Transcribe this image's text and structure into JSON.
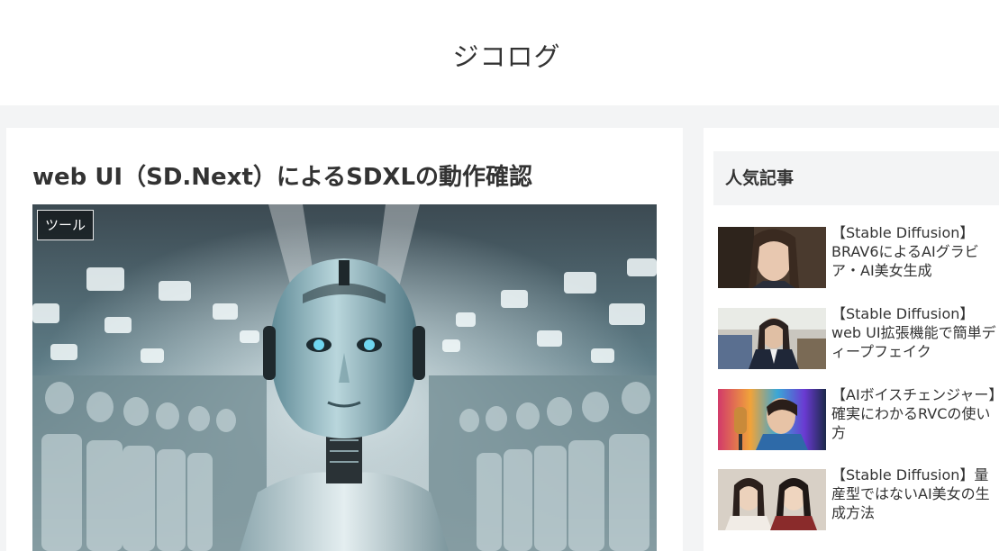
{
  "header": {
    "site_title": "ジコログ"
  },
  "article": {
    "title": "web UI（SD.Next）によるSDXLの動作確認",
    "category": "ツール"
  },
  "sidebar": {
    "widget_title": "人気記事",
    "items": [
      {
        "title": "【Stable Diffusion】BRAV6によるAIグラビア・AI美女生成"
      },
      {
        "title": "【Stable Diffusion】web UI拡張機能で簡単ディープフェイク"
      },
      {
        "title": "【AIボイスチェンジャー】確実にわかるRVCの使い方"
      },
      {
        "title": "【Stable Diffusion】量産型ではないAI美女の生成方法"
      }
    ]
  },
  "colors": {
    "page_bg": "#f3f4f5",
    "card_bg": "#ffffff",
    "text": "#333333"
  }
}
